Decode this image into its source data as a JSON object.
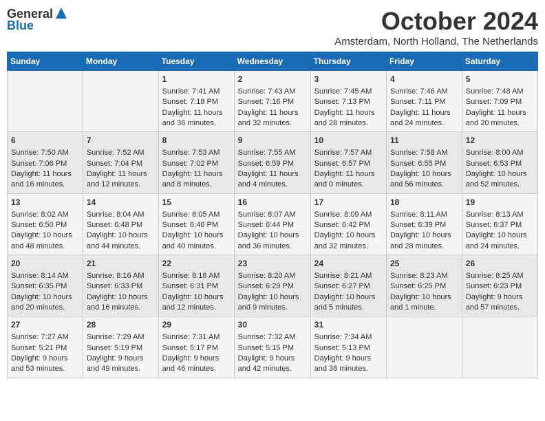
{
  "header": {
    "logo_general": "General",
    "logo_blue": "Blue",
    "month": "October 2024",
    "location": "Amsterdam, North Holland, The Netherlands"
  },
  "weekdays": [
    "Sunday",
    "Monday",
    "Tuesday",
    "Wednesday",
    "Thursday",
    "Friday",
    "Saturday"
  ],
  "weeks": [
    [
      {
        "day": "",
        "info": ""
      },
      {
        "day": "",
        "info": ""
      },
      {
        "day": "1",
        "info": "Sunrise: 7:41 AM\nSunset: 7:18 PM\nDaylight: 11 hours and 36 minutes."
      },
      {
        "day": "2",
        "info": "Sunrise: 7:43 AM\nSunset: 7:16 PM\nDaylight: 11 hours and 32 minutes."
      },
      {
        "day": "3",
        "info": "Sunrise: 7:45 AM\nSunset: 7:13 PM\nDaylight: 11 hours and 28 minutes."
      },
      {
        "day": "4",
        "info": "Sunrise: 7:46 AM\nSunset: 7:11 PM\nDaylight: 11 hours and 24 minutes."
      },
      {
        "day": "5",
        "info": "Sunrise: 7:48 AM\nSunset: 7:09 PM\nDaylight: 11 hours and 20 minutes."
      }
    ],
    [
      {
        "day": "6",
        "info": "Sunrise: 7:50 AM\nSunset: 7:06 PM\nDaylight: 11 hours and 16 minutes."
      },
      {
        "day": "7",
        "info": "Sunrise: 7:52 AM\nSunset: 7:04 PM\nDaylight: 11 hours and 12 minutes."
      },
      {
        "day": "8",
        "info": "Sunrise: 7:53 AM\nSunset: 7:02 PM\nDaylight: 11 hours and 8 minutes."
      },
      {
        "day": "9",
        "info": "Sunrise: 7:55 AM\nSunset: 6:59 PM\nDaylight: 11 hours and 4 minutes."
      },
      {
        "day": "10",
        "info": "Sunrise: 7:57 AM\nSunset: 6:57 PM\nDaylight: 11 hours and 0 minutes."
      },
      {
        "day": "11",
        "info": "Sunrise: 7:58 AM\nSunset: 6:55 PM\nDaylight: 10 hours and 56 minutes."
      },
      {
        "day": "12",
        "info": "Sunrise: 8:00 AM\nSunset: 6:53 PM\nDaylight: 10 hours and 52 minutes."
      }
    ],
    [
      {
        "day": "13",
        "info": "Sunrise: 8:02 AM\nSunset: 6:50 PM\nDaylight: 10 hours and 48 minutes."
      },
      {
        "day": "14",
        "info": "Sunrise: 8:04 AM\nSunset: 6:48 PM\nDaylight: 10 hours and 44 minutes."
      },
      {
        "day": "15",
        "info": "Sunrise: 8:05 AM\nSunset: 6:46 PM\nDaylight: 10 hours and 40 minutes."
      },
      {
        "day": "16",
        "info": "Sunrise: 8:07 AM\nSunset: 6:44 PM\nDaylight: 10 hours and 36 minutes."
      },
      {
        "day": "17",
        "info": "Sunrise: 8:09 AM\nSunset: 6:42 PM\nDaylight: 10 hours and 32 minutes."
      },
      {
        "day": "18",
        "info": "Sunrise: 8:11 AM\nSunset: 6:39 PM\nDaylight: 10 hours and 28 minutes."
      },
      {
        "day": "19",
        "info": "Sunrise: 8:13 AM\nSunset: 6:37 PM\nDaylight: 10 hours and 24 minutes."
      }
    ],
    [
      {
        "day": "20",
        "info": "Sunrise: 8:14 AM\nSunset: 6:35 PM\nDaylight: 10 hours and 20 minutes."
      },
      {
        "day": "21",
        "info": "Sunrise: 8:16 AM\nSunset: 6:33 PM\nDaylight: 10 hours and 16 minutes."
      },
      {
        "day": "22",
        "info": "Sunrise: 8:18 AM\nSunset: 6:31 PM\nDaylight: 10 hours and 12 minutes."
      },
      {
        "day": "23",
        "info": "Sunrise: 8:20 AM\nSunset: 6:29 PM\nDaylight: 10 hours and 9 minutes."
      },
      {
        "day": "24",
        "info": "Sunrise: 8:21 AM\nSunset: 6:27 PM\nDaylight: 10 hours and 5 minutes."
      },
      {
        "day": "25",
        "info": "Sunrise: 8:23 AM\nSunset: 6:25 PM\nDaylight: 10 hours and 1 minute."
      },
      {
        "day": "26",
        "info": "Sunrise: 8:25 AM\nSunset: 6:23 PM\nDaylight: 9 hours and 57 minutes."
      }
    ],
    [
      {
        "day": "27",
        "info": "Sunrise: 7:27 AM\nSunset: 5:21 PM\nDaylight: 9 hours and 53 minutes."
      },
      {
        "day": "28",
        "info": "Sunrise: 7:29 AM\nSunset: 5:19 PM\nDaylight: 9 hours and 49 minutes."
      },
      {
        "day": "29",
        "info": "Sunrise: 7:31 AM\nSunset: 5:17 PM\nDaylight: 9 hours and 46 minutes."
      },
      {
        "day": "30",
        "info": "Sunrise: 7:32 AM\nSunset: 5:15 PM\nDaylight: 9 hours and 42 minutes."
      },
      {
        "day": "31",
        "info": "Sunrise: 7:34 AM\nSunset: 5:13 PM\nDaylight: 9 hours and 38 minutes."
      },
      {
        "day": "",
        "info": ""
      },
      {
        "day": "",
        "info": ""
      }
    ]
  ]
}
